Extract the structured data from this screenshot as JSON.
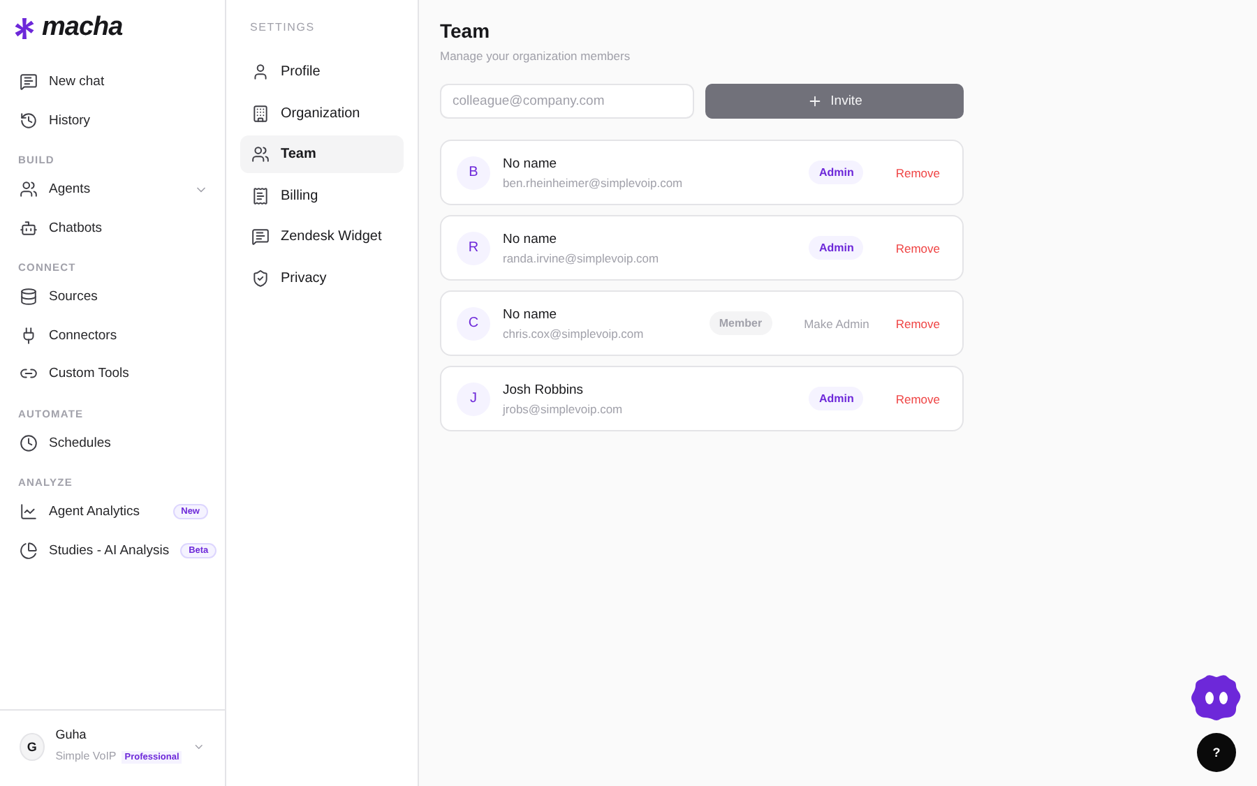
{
  "brand": "macha",
  "sidebar": {
    "top_items": [
      {
        "label": "New chat"
      },
      {
        "label": "History"
      }
    ],
    "sections": [
      {
        "title": "BUILD",
        "items": [
          {
            "label": "Agents",
            "expanded": false
          },
          {
            "label": "Chatbots"
          }
        ]
      },
      {
        "title": "CONNECT",
        "items": [
          {
            "label": "Sources"
          },
          {
            "label": "Connectors"
          },
          {
            "label": "Custom Tools"
          }
        ]
      },
      {
        "title": "AUTOMATE",
        "items": [
          {
            "label": "Schedules"
          }
        ]
      },
      {
        "title": "ANALYZE",
        "items": [
          {
            "label": "Agent Analytics",
            "badge": "New"
          },
          {
            "label": "Studies - AI Analysis",
            "badge": "Beta"
          }
        ]
      }
    ],
    "user": {
      "initial": "G",
      "name": "Guha",
      "org": "Simple VoIP",
      "plan": "Professional"
    }
  },
  "settings_nav": {
    "title": "SETTINGS",
    "items": [
      {
        "label": "Profile",
        "selected": false
      },
      {
        "label": "Organization",
        "selected": false
      },
      {
        "label": "Team",
        "selected": true
      },
      {
        "label": "Billing",
        "selected": false
      },
      {
        "label": "Zendesk Widget",
        "selected": false
      },
      {
        "label": "Privacy",
        "selected": false
      }
    ]
  },
  "team": {
    "title": "Team",
    "subtitle": "Manage your organization members",
    "invite_field": {
      "placeholder": "colleague@company.com"
    },
    "invite_button": "Invite",
    "members": [
      {
        "initial": "B",
        "name": "No name",
        "email": "ben.rheinheimer@simplevoip.com",
        "role": {
          "label": "Admin",
          "kind": "admin"
        },
        "remove": "Remove"
      },
      {
        "initial": "R",
        "name": "No name",
        "email": "randa.irvine@simplevoip.com",
        "role": {
          "label": "Admin",
          "kind": "admin"
        },
        "remove": "Remove"
      },
      {
        "initial": "C",
        "name": "No name",
        "email": "chris.cox@simplevoip.com",
        "role": {
          "label": "Member",
          "kind": "member"
        },
        "make_admin": "Make Admin",
        "remove": "Remove"
      },
      {
        "initial": "J",
        "name": "Josh Robbins",
        "email": "jrobs@simplevoip.com",
        "role": {
          "label": "Admin",
          "kind": "admin"
        },
        "remove": "Remove"
      }
    ]
  },
  "help_button": "?"
}
